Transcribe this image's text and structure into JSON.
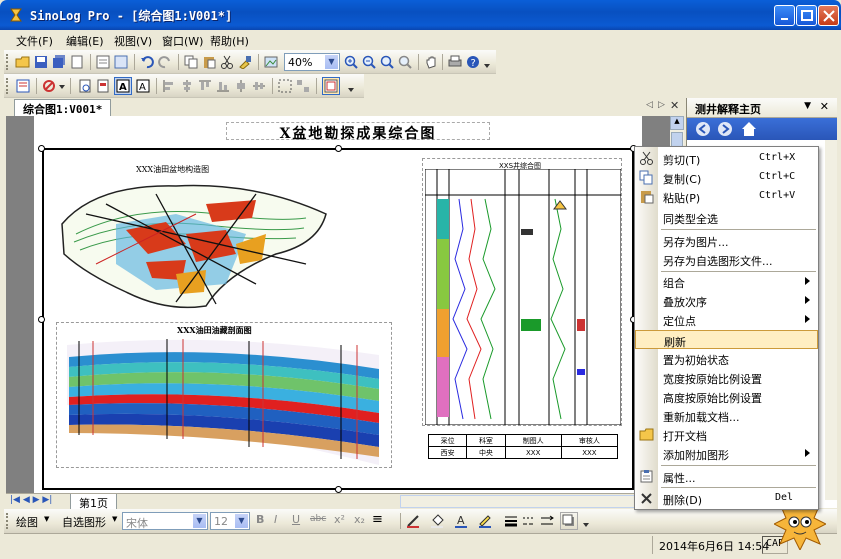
{
  "window": {
    "title": "SinoLog Pro - [综合图1:V001*]"
  },
  "menu": [
    "文件(F)",
    "编辑(E)",
    "视图(V)",
    "窗口(W)",
    "帮助(H)"
  ],
  "toolbar": {
    "zoom_value": "40%"
  },
  "document": {
    "tab_label": "综合图1:V001*",
    "page_title": "X盆地勘探成果综合图",
    "map_title": "XXX油田盆地构造图",
    "section_title": "XXX油田油藏剖面图",
    "well_title": "XXS井综合图",
    "signoff": {
      "headers": [
        "采位",
        "科室",
        "制图人",
        "审核人"
      ],
      "values": [
        "西安",
        "中央",
        "XXX",
        "XXX"
      ]
    }
  },
  "sheet_tab": "第1页",
  "drawbar": {
    "draw_label": "绘图",
    "autoshape_label": "自选图形",
    "font_value": "宋体",
    "size_value": "12"
  },
  "statusbar": {
    "datetime": "2014年6月6日 14:54",
    "caps": "CAP"
  },
  "taskpane": {
    "title": "测井解释主页"
  },
  "context_menu": {
    "items": [
      {
        "label": "剪切(T)",
        "shortcut": "Ctrl+X",
        "icon": "scissors-icon"
      },
      {
        "label": "复制(C)",
        "shortcut": "Ctrl+C",
        "icon": "copy-icon"
      },
      {
        "label": "粘贴(P)",
        "shortcut": "Ctrl+V",
        "icon": "paste-icon"
      },
      {
        "label": "同类型全选"
      },
      {
        "label": "另存为图片..."
      },
      {
        "label": "另存为自选图形文件..."
      },
      {
        "label": "组合",
        "submenu": true
      },
      {
        "label": "叠放次序",
        "submenu": true
      },
      {
        "label": "定位点",
        "submenu": true
      },
      {
        "label": "刷新",
        "highlighted": true
      },
      {
        "label": "置为初始状态"
      },
      {
        "label": "宽度按原始比例设置"
      },
      {
        "label": "高度按原始比例设置"
      },
      {
        "label": "重新加载文档..."
      },
      {
        "label": "打开文档",
        "icon": "folder-icon"
      },
      {
        "label": "添加附加图形",
        "submenu": true
      },
      {
        "label": "属性...",
        "icon": "properties-icon"
      },
      {
        "label": "删除(D)",
        "shortcut": "Del",
        "icon": "delete-icon"
      }
    ]
  },
  "colors": {
    "titlebar": "#0a5fd8",
    "highlight": "#ffeec2",
    "taskpane_nav": "#2a56b8"
  }
}
